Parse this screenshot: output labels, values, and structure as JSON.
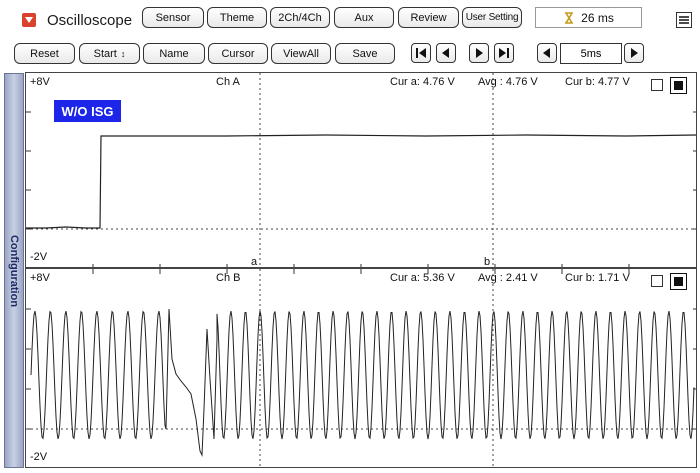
{
  "app": {
    "title": "Oscilloscope",
    "time_value": "26 ms"
  },
  "toolbar_top": {
    "sensor": "Sensor",
    "theme": "Theme",
    "channels": "2Ch/4Ch",
    "aux": "Aux",
    "review": "Review",
    "user_setting": "User Setting"
  },
  "toolbar_second": {
    "reset": "Reset",
    "start": "Start",
    "name": "Name",
    "cursor": "Cursor",
    "view_all": "ViewAll",
    "save": "Save",
    "timebase": "5ms"
  },
  "sidebar": {
    "configuration": "Configuration"
  },
  "channel_a": {
    "name": "Ch A",
    "top_label": "+8V",
    "bottom_label": "-2V",
    "cur_a": "Cur a: 4.76 V",
    "avg": "Avg  : 4.76 V",
    "cur_b": "Cur b: 4.77 V",
    "cursor_a_label": "a",
    "cursor_b_label": "b",
    "badge": "W/O ISG"
  },
  "channel_b": {
    "name": "Ch B",
    "top_label": "+8V",
    "bottom_label": "-2V",
    "cur_a": "Cur a: 5.36 V",
    "avg": "Avg  : 2.41 V",
    "cur_b": "Cur b: 1.71 V"
  },
  "colors": {
    "badge_bg": "#1d26e8",
    "app_icon": "#d9432b",
    "sidebar_tab": "#9aa5c4"
  }
}
